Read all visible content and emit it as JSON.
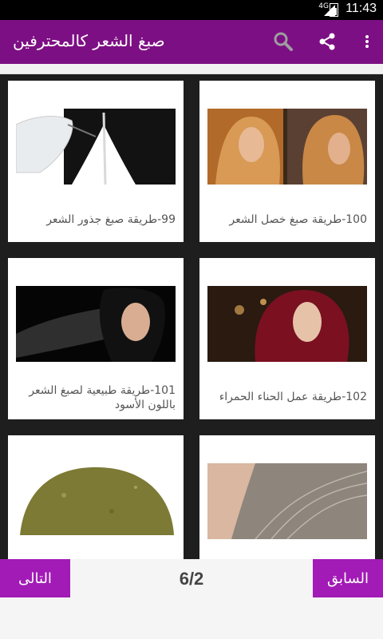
{
  "status_bar": {
    "network": "4G",
    "time": "11:43",
    "icons": [
      "signal-icon",
      "battery-icon"
    ]
  },
  "app_bar": {
    "title": "صبغ الشعر كالمحترفين",
    "actions": [
      "search-icon",
      "share-icon",
      "more-vert-icon"
    ]
  },
  "cards": [
    {
      "caption": "100-طريقة صبغ خصل الشعر",
      "image": "blonde-highlights-photo"
    },
    {
      "caption": "99-طريقة صبغ جذور الشعر",
      "image": "hair-roots-dye-photo"
    },
    {
      "caption": "102-طريقة عمل الحناء الحمراء",
      "image": "red-hair-woman-photo"
    },
    {
      "caption": "101-طريقة طبيعية لصبغ الشعر باللون الأسود",
      "image": "black-hair-woman-photo"
    },
    {
      "caption": "",
      "image": "grey-hair-closeup-photo"
    },
    {
      "caption": "",
      "image": "henna-powder-photo"
    }
  ],
  "pager": {
    "previous_label": "السابق",
    "next_label": "التالى",
    "page_indicator": "6/2"
  },
  "colors": {
    "app_bar": "#7d0f84",
    "pager_button": "#a21bb6",
    "background": "#1e1e1e"
  }
}
